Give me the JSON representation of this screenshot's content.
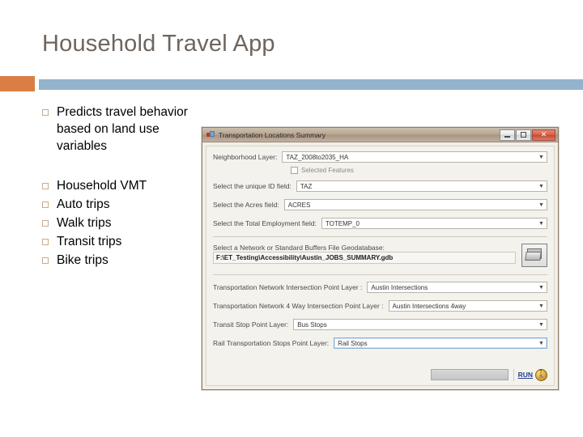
{
  "slide": {
    "title": "Household Travel App",
    "accent_orange": "#d97f45",
    "accent_blue": "#93b3cd",
    "title_color": "#6f655e"
  },
  "bullets": [
    {
      "text": "Predicts travel behavior based on land use variables"
    },
    {
      "text": "Household VMT"
    },
    {
      "text": "Auto trips"
    },
    {
      "text": "Walk trips"
    },
    {
      "text": "Transit trips"
    },
    {
      "text": "Bike trips"
    }
  ],
  "app_window": {
    "title": "Transportation Locations Summary",
    "window_buttons": {
      "minimize": "—",
      "maximize": "❐",
      "close": "✕"
    },
    "fields": [
      {
        "label": "Neighborhood Layer:",
        "value": "TAZ_2008to2035_HA",
        "name": "neighborhood-layer"
      },
      {
        "label": "Select the unique ID field:",
        "value": "TAZ",
        "name": "unique-id-field"
      },
      {
        "label": "Select the Acres field:",
        "value": "ACRES",
        "name": "acres-field"
      },
      {
        "label": "Select the Total Employment field:",
        "value": "TOTEMP_0",
        "name": "total-employment-field"
      }
    ],
    "selected_features_label": "Selected Features",
    "selected_features_checked": false,
    "file_section": {
      "caption": "Select a Network or Standard Buffers File Geodatabase:",
      "path": "F:\\ET_Testing\\Accessibility\\Austin_JOBS_SUMMARY.gdb",
      "browse_icon": "folder-open-icon"
    },
    "layer_fields": [
      {
        "label": "Transportation Network Intersection Point Layer :",
        "value": "Austin Intersections",
        "name": "network-intersection-point-layer"
      },
      {
        "label": "Transportation Network 4 Way Intersection Point Layer :",
        "value": "Austin Intersections 4way",
        "name": "network-4way-intersection-point-layer"
      },
      {
        "label": "Transit Stop Point Layer:",
        "value": "Bus Stops",
        "name": "transit-stop-point-layer"
      },
      {
        "label": "Rail Transportation Stops Point Layer:",
        "value": "Rail Stops",
        "name": "rail-stops-point-layer"
      }
    ],
    "run": {
      "label": "RUN",
      "icon": "running-person-icon",
      "link_color": "#25408f"
    },
    "dropdown_arrow": "▼"
  }
}
